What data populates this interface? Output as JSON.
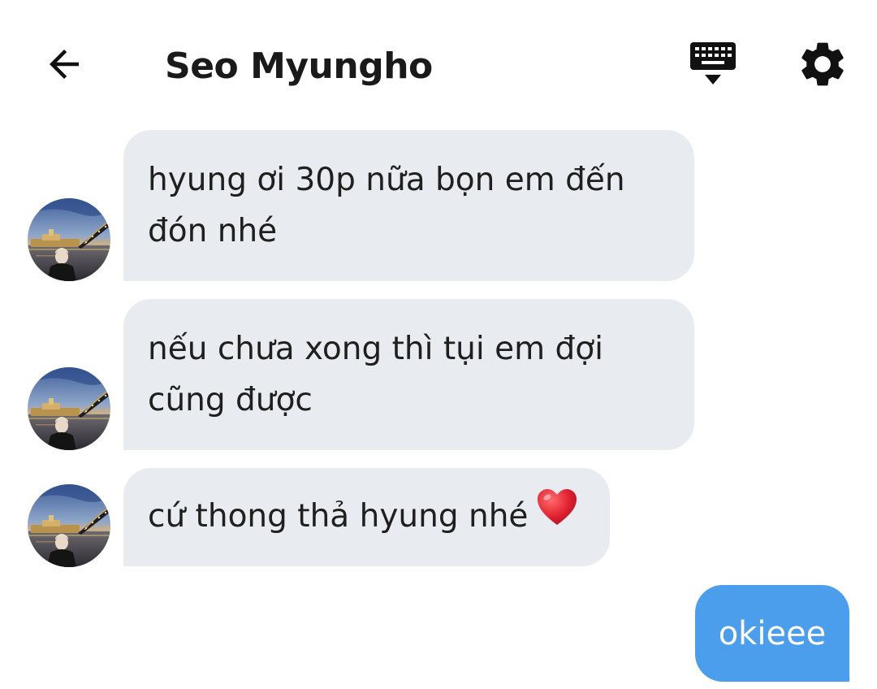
{
  "header": {
    "title": "Seo Myungho",
    "back_icon": "arrow-left-icon",
    "keyboard_icon": "keyboard-hide-icon",
    "settings_icon": "gear-icon"
  },
  "messages": [
    {
      "direction": "incoming",
      "lines": [
        "hyung ơi 30p nữa bọn em đến",
        "đón nhé"
      ]
    },
    {
      "direction": "incoming",
      "lines": [
        "nếu chưa xong thì tụi em đợi",
        "cũng được"
      ]
    },
    {
      "direction": "incoming",
      "lines": [
        "cứ thong thả hyung nhé"
      ],
      "emoji": "heart-emoji"
    },
    {
      "direction": "outgoing",
      "lines": [
        "okieee"
      ]
    }
  ],
  "colors": {
    "incoming_bubble": "#e8ebef",
    "outgoing_bubble": "#4a9eeb",
    "heart": "#e0202f"
  }
}
